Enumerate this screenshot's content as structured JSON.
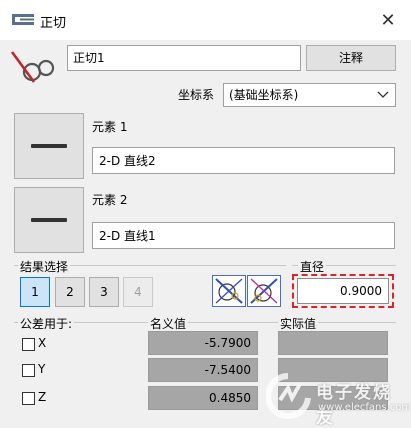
{
  "window": {
    "title": "正切",
    "close_glyph": "✕"
  },
  "name_field": {
    "value": "正切1"
  },
  "comment_button": {
    "label": "注释"
  },
  "coord_system": {
    "label": "坐标系",
    "selected": "(基础坐标系)"
  },
  "element1": {
    "label": "元素 1",
    "value": "2-D 直线2"
  },
  "element2": {
    "label": "元素 2",
    "value": "2-D 直线1"
  },
  "result_select": {
    "label": "结果选择",
    "options": [
      {
        "label": "1",
        "state": "selected"
      },
      {
        "label": "2",
        "state": "normal"
      },
      {
        "label": "3",
        "state": "normal"
      },
      {
        "label": "4",
        "state": "disabled"
      }
    ]
  },
  "diameter": {
    "label": "直径",
    "value": "0.9000"
  },
  "tolerance": {
    "label": "公差用于:",
    "nominal_header": "名义值",
    "actual_header": "实际值",
    "rows": [
      {
        "axis": "X",
        "nominal": "-5.7900"
      },
      {
        "axis": "Y",
        "nominal": "-7.5400"
      },
      {
        "axis": "Z",
        "nominal": "0.4850"
      }
    ]
  },
  "watermark": {
    "cn": "电子发烧友",
    "en": "www.elecfans.com"
  },
  "colors": {
    "highlight": "#d9262c",
    "selected": "#cce4f7",
    "accent": "#0078d7"
  }
}
